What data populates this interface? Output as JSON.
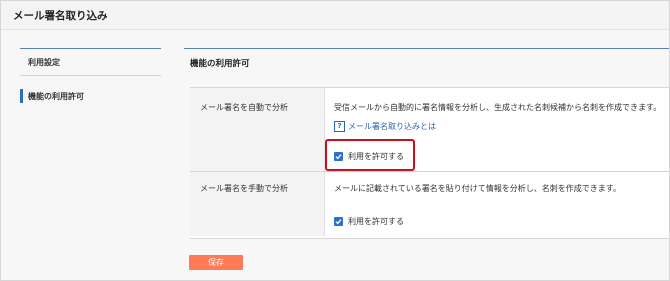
{
  "header": {
    "title": "メール署名取り込み"
  },
  "sidebar": {
    "items": [
      {
        "label": "利用設定"
      },
      {
        "label": "機能の利用許可"
      }
    ]
  },
  "main": {
    "section_title": "機能の利用許可",
    "rows": [
      {
        "label": "メール署名を自動で分析",
        "description": "受信メールから自動的に署名情報を分析し、生成された名刺候補から名刺を作成できます。",
        "help_link": "メール署名取り込みとは",
        "checkbox_label": "利用を許可する",
        "checked": true
      },
      {
        "label": "メール署名を手動で分析",
        "description": "メールに記載されている署名を貼り付けて情報を分析し、名刺を作成できます。",
        "checkbox_label": "利用を許可する",
        "checked": true
      }
    ],
    "save_label": "保存"
  },
  "colors": {
    "accent": "#2b73c9",
    "link": "#2a62b8",
    "save_button": "#ff7a56",
    "highlight": "#c8101e"
  }
}
